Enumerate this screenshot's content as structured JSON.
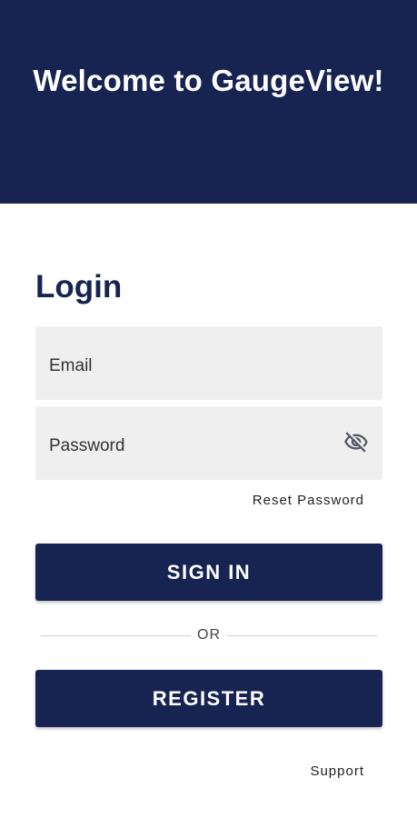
{
  "header": {
    "title": "Welcome to GaugeView!",
    "background_color": "#172452"
  },
  "login": {
    "heading": "Login",
    "email_label": "Email",
    "password_label": "Password",
    "password_toggle_icon": "eye-off-icon",
    "reset_password_label": "Reset Password",
    "sign_in_label": "SIGN IN",
    "or_label": "OR",
    "register_label": "REGISTER",
    "support_label": "Support"
  },
  "colors": {
    "primary": "#172452",
    "field_background": "#efefef",
    "button_text": "#ffffff"
  }
}
